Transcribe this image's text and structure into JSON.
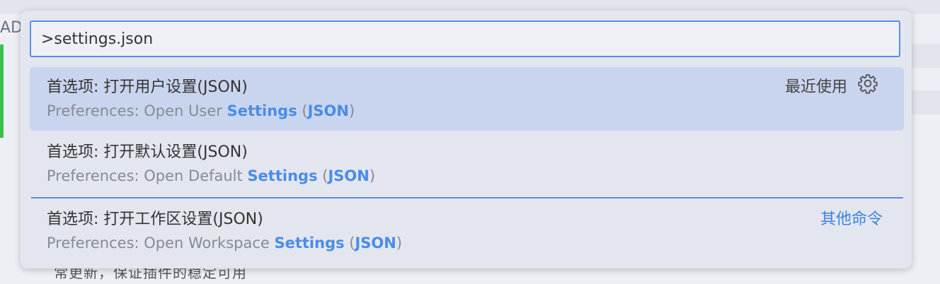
{
  "background": {
    "left_text": "AD",
    "bottom_text": "常更新，保证插件的稳定可用"
  },
  "palette": {
    "input_value": ">settings.json",
    "items": [
      {
        "title": "首选项: 打开用户设置(JSON)",
        "sub_prefix": "Preferences: Open User ",
        "sub_hl1": "Settings",
        "sub_mid": " (",
        "sub_hl2": "JSON",
        "sub_suffix": ")",
        "right_label": "最近使用",
        "right_icon": "gear-icon",
        "selected": true
      },
      {
        "title": "首选项: 打开默认设置(JSON)",
        "sub_prefix": "Preferences: Open Default ",
        "sub_hl1": "Settings",
        "sub_mid": " (",
        "sub_hl2": "JSON",
        "sub_suffix": ")",
        "selected": false
      },
      {
        "title": "首选项: 打开工作区设置(JSON)",
        "sub_prefix": "Preferences: Open Workspace ",
        "sub_hl1": "Settings",
        "sub_mid": " (",
        "sub_hl2": "JSON",
        "sub_suffix": ")",
        "right_link": "其他命令",
        "selected": false
      }
    ]
  },
  "colors": {
    "accent": "#4a8ce8",
    "selected_bg": "#c9d5ee",
    "link": "#3b82e0"
  }
}
